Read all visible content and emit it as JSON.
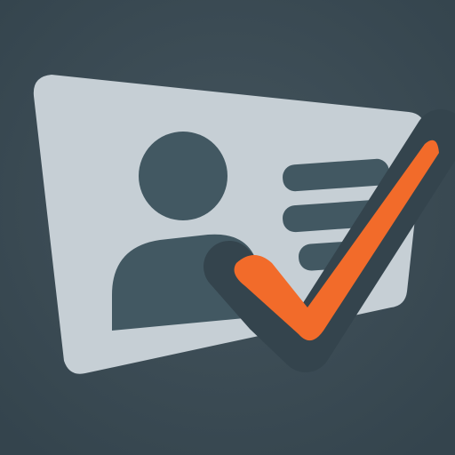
{
  "icon": {
    "name": "contact-card-verified-icon",
    "colors": {
      "background": "#3a4a54",
      "card": "#c6cfd5",
      "figure": "#425862",
      "check": "#f26b2a",
      "check_outline": "#34444d"
    }
  }
}
